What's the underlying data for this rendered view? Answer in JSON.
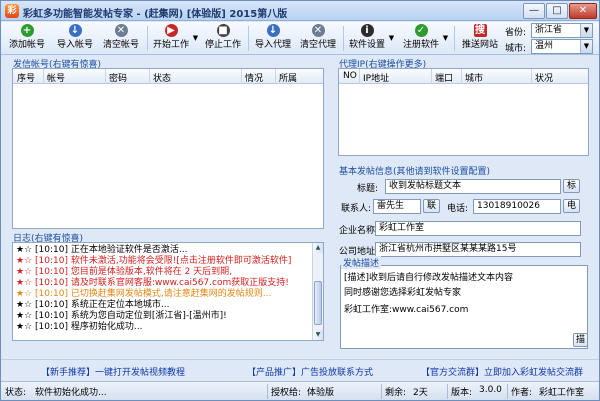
{
  "window": {
    "title": "彩虹多功能智能发帖专家 - (赶集网)    [体验版]    2015第八版",
    "app_icon": "彩",
    "minimize": "—",
    "maximize": "□",
    "close": "✕"
  },
  "toolbar": {
    "buttons": [
      {
        "label": "添加帐号",
        "icon": "add-icon",
        "glyph": "+",
        "color": "#2f9a2f"
      },
      {
        "label": "导入帐号",
        "icon": "import-icon",
        "glyph": "↓",
        "color": "#3a6fc2"
      },
      {
        "label": "清空帐号",
        "icon": "clear-icon",
        "glyph": "✕",
        "color": "#6b7c93"
      },
      {
        "label": "开始工作",
        "icon": "play-icon",
        "glyph": "▶",
        "color": "#c62828"
      },
      {
        "label": "停止工作",
        "icon": "stop-icon",
        "glyph": "■",
        "color": "#444444"
      },
      {
        "label": "导入代理",
        "icon": "import-proxy-icon",
        "glyph": "↓",
        "color": "#3a6fc2"
      },
      {
        "label": "清空代理",
        "icon": "clear-proxy-icon",
        "glyph": "✕",
        "color": "#6b7c93"
      },
      {
        "label": "软件设置",
        "icon": "info-icon",
        "glyph": "i",
        "color": "#2b2b2b"
      },
      {
        "label": "注册软件",
        "icon": "register-icon",
        "glyph": "✓",
        "color": "#2f9a2f"
      },
      {
        "label": "推送网站",
        "icon": "push-site-icon",
        "glyph": "搜",
        "color": "#c62828"
      }
    ],
    "dropdown_arrow": "▼",
    "province_label": "省份:",
    "province_value": "浙江省",
    "city_label": "城市:",
    "city_value": "温州"
  },
  "accounts": {
    "title": "发信帐号(右键有惊喜)",
    "columns": [
      "序号",
      "帐号",
      "密码",
      "状态",
      "情况",
      "所属"
    ]
  },
  "proxy": {
    "title": "代理IP(右键操作更多)",
    "columns": [
      "NO",
      "IP地址",
      "端口",
      "城市",
      "状况"
    ]
  },
  "log": {
    "title": "日志(右键有惊喜)",
    "star": "★☆",
    "lines": [
      {
        "time": "[10:10]",
        "text": "正在本地验证软件是否激活...",
        "color": "#000000"
      },
      {
        "time": "[10:10]",
        "text": "软件未激活,功能将会受限![点击注册软件即可激活软件]",
        "color": "#d41e1e"
      },
      {
        "time": "[10:10]",
        "text": "您目前是体验版本,软件将在 2 天后到期,",
        "color": "#d41e1e"
      },
      {
        "time": "[10:10]",
        "text": "请及时联系官网客服:www.cai567.com获取正版支持!",
        "color": "#d41e1e"
      },
      {
        "time": "[10:10]",
        "text": "已切换赶集网发帖模式,请注意赶集网的发帖规则...",
        "color": "#e38714"
      },
      {
        "time": "[10:10]",
        "text": "系统正在定位本地城市...",
        "color": "#000000"
      },
      {
        "time": "[10:10]",
        "text": "系统为您自动定位到[浙江省]-[温州市]!",
        "color": "#000000"
      },
      {
        "time": "[10:10]",
        "text": "程序初始化成功...",
        "color": "#000000"
      }
    ],
    "scroll_up": "▲",
    "scroll_down": "▼"
  },
  "post": {
    "title": "基本发帖信息(其他请到软件设置配置)",
    "subject_label": "标题:",
    "subject_value": "收到发帖标题文本",
    "subject_btn": "标",
    "contact_label": "联系人:",
    "contact_value": "雷先生",
    "contact_btn": "联",
    "phone_label": "电话:",
    "phone_value": "13018910026",
    "phone_btn": "电",
    "company_label": "企业名称:",
    "company_value": "彩虹工作室",
    "address_label": "公司地址:",
    "address_value": "浙江省杭州市拱墅区某某某路15号",
    "desc_label": "发帖描述",
    "desc_lines": [
      "[描述]收到后请自行修改发帖描述文本内容",
      "同时感谢您选择彩虹发帖专家",
      "彩虹工作室:www.cai567.com"
    ],
    "desc_btn": "描"
  },
  "links": {
    "tutorial": "【新手推荐】一键打开发帖视频教程",
    "ads": "【产品推广】广告投放联系方式",
    "group": "【官方交流群】立即加入彩虹发帖交流群"
  },
  "status": {
    "state_label": "状态:",
    "state_value": "软件初始化成功...",
    "auth_label": "授权给:",
    "auth_value": "体验版",
    "remain_label": "剩余:",
    "remain_value": "2天",
    "version_label": "版本:",
    "version_value": "3.0.0",
    "author_label": "作者:",
    "author_value": "彩虹工作室"
  }
}
